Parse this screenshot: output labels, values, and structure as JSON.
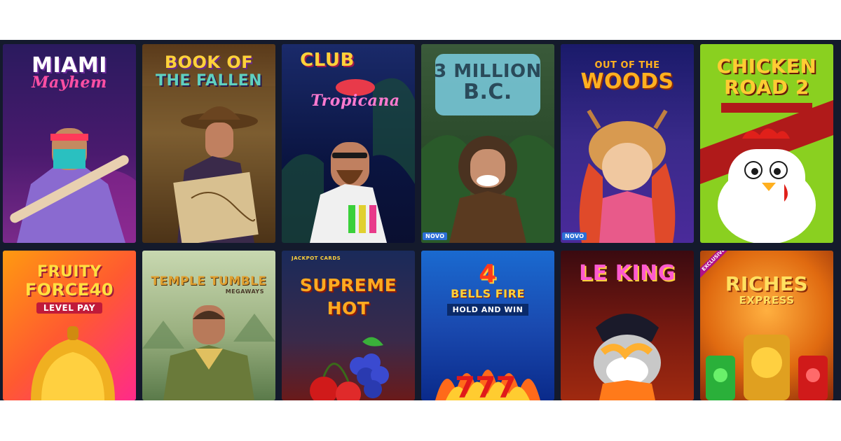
{
  "games": [
    {
      "id": "miami-mayhem",
      "title_line1": "MIAMI",
      "title_line2": "Mayhem",
      "badge": "",
      "colors": {
        "bg1": "#2a1a5e",
        "bg2": "#7a2a8a",
        "accent": "#ff4fa3"
      }
    },
    {
      "id": "book-of-the-fallen",
      "title_line1": "BOOK OF",
      "title_line2": "THE FALLEN",
      "badge": "",
      "colors": {
        "bg1": "#3a2410",
        "bg2": "#8a6a3a",
        "accent": "#5fd0c0"
      }
    },
    {
      "id": "club-tropicana",
      "title_line1": "CLUB",
      "title_line2": "Tropicana",
      "badge": "",
      "colors": {
        "bg1": "#1a2a6a",
        "bg2": "#0a0f30",
        "accent": "#ffd23a"
      }
    },
    {
      "id": "3-million-bc",
      "title_line1": "3 MILLION",
      "title_line2": "B.C.",
      "badge": "NOVO",
      "colors": {
        "bg1": "#2a4a2a",
        "bg2": "#5a7a3a",
        "accent": "#6fd0ff"
      }
    },
    {
      "id": "out-of-the-woods",
      "title_line1": "OUT OF THE",
      "title_line2": "WOODS",
      "badge": "NOVO",
      "colors": {
        "bg1": "#1a1a6a",
        "bg2": "#4a2a9a",
        "accent": "#ffb020"
      }
    },
    {
      "id": "chicken-road-2",
      "title_line1": "CHICKEN",
      "title_line2": "ROAD 2",
      "badge": "",
      "colors": {
        "bg1": "#8ad020",
        "bg2": "#b01a1a",
        "accent": "#ffcc33"
      }
    },
    {
      "id": "fruity-force-40",
      "title_line1": "FRUITY",
      "title_line2": "FORCE40",
      "title_line3": "LEVEL PAY",
      "badge": "",
      "colors": {
        "bg1": "#ff7a10",
        "bg2": "#ff2a8a",
        "accent": "#ffe040"
      }
    },
    {
      "id": "temple-tumble",
      "title_line1": "TEMPLE TUMBLE",
      "title_line2": "MEGAWAYS",
      "badge": "",
      "colors": {
        "bg1": "#c8d8b0",
        "bg2": "#5a7a4a",
        "accent": "#e0a030"
      }
    },
    {
      "id": "supreme-hot",
      "title_line1": "SUPREME",
      "title_line2": "HOT",
      "title_line3": "JACKPOT CARDS",
      "badge": "",
      "colors": {
        "bg1": "#1a2a5a",
        "bg2": "#6a1a1a",
        "accent": "#ffaa20"
      }
    },
    {
      "id": "4-bells-fire",
      "title_line1": "4",
      "title_line2": "BELLS FIRE",
      "title_line3": "HOLD AND WIN",
      "badge": "",
      "colors": {
        "bg1": "#1a5ad0",
        "bg2": "#0a2a8a",
        "accent": "#ff3a1a"
      }
    },
    {
      "id": "le-king",
      "title_line1": "LE KING",
      "title_line2": "",
      "badge": "",
      "colors": {
        "bg1": "#4a1010",
        "bg2": "#a02a10",
        "accent": "#ff5ad0"
      }
    },
    {
      "id": "riches-express",
      "title_line1": "RICHES",
      "title_line2": "EXPRESS",
      "badge": "",
      "ribbon": "EXCLUSIVE",
      "colors": {
        "bg1": "#d04a10",
        "bg2": "#ffa020",
        "accent": "#ffe060"
      }
    }
  ]
}
